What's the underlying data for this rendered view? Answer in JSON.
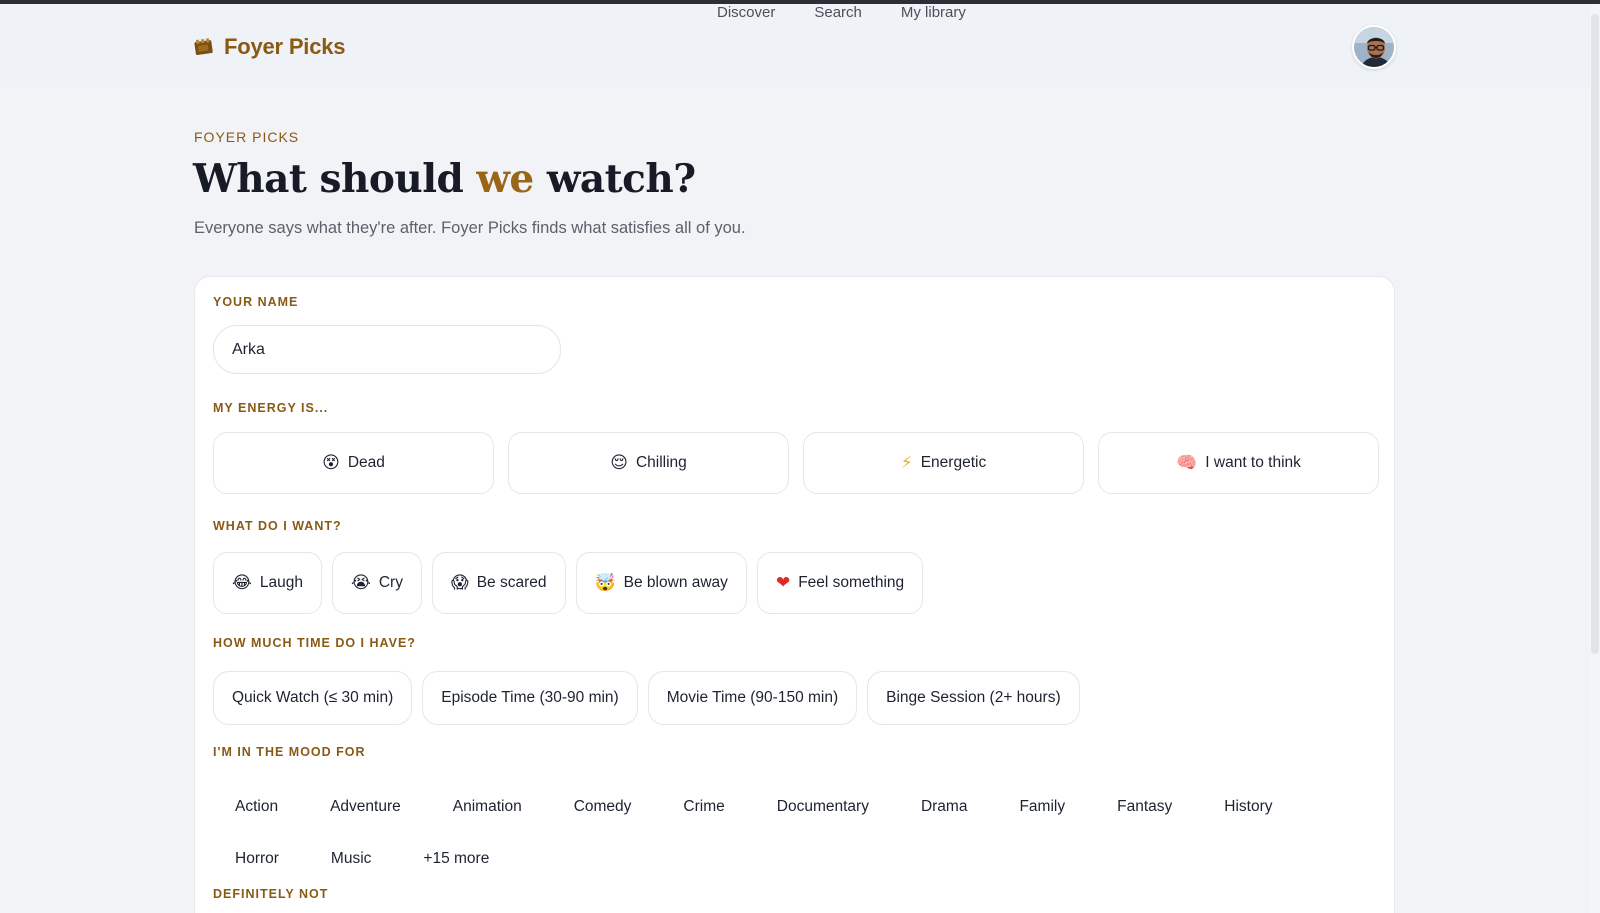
{
  "brand": {
    "name": "Foyer Picks"
  },
  "nav": {
    "items": [
      "Discover",
      "Search",
      "My library"
    ]
  },
  "hero": {
    "eyebrow": "FOYER PICKS",
    "title_before": "What should ",
    "title_accent": "we",
    "title_after": " watch?",
    "subtitle": "Everyone says what they're after. Foyer Picks finds what satisfies all of you."
  },
  "form": {
    "name_label": "YOUR NAME",
    "name_value": "Arka",
    "energy_label": "MY ENERGY IS...",
    "energy_options": [
      {
        "emoji": "😵",
        "label": "Dead"
      },
      {
        "emoji": "😌",
        "label": "Chilling"
      },
      {
        "emoji": "⚡",
        "label": "Energetic"
      },
      {
        "emoji": "🧠",
        "label": "I want to think"
      }
    ],
    "want_label": "WHAT DO I WANT?",
    "want_options": [
      {
        "emoji": "😂",
        "label": "Laugh"
      },
      {
        "emoji": "😭",
        "label": "Cry"
      },
      {
        "emoji": "😱",
        "label": "Be scared"
      },
      {
        "emoji": "🤯",
        "label": "Be blown away"
      },
      {
        "emoji": "❤",
        "label": "Feel something"
      }
    ],
    "time_label": "HOW MUCH TIME DO I HAVE?",
    "time_options": [
      "Quick Watch (≤ 30 min)",
      "Episode Time (30-90 min)",
      "Movie Time (90-150 min)",
      "Binge Session (2+ hours)"
    ],
    "mood_label": "I'M IN THE MOOD FOR",
    "genres_row1": [
      "Action",
      "Adventure",
      "Animation",
      "Comedy",
      "Crime",
      "Documentary",
      "Drama",
      "Family",
      "Fantasy",
      "History"
    ],
    "genres_row2": [
      "Horror",
      "Music",
      "+15 more"
    ],
    "definitely_not_label": "DEFINITELY NOT"
  },
  "colors": {
    "accent": "#8a5a14",
    "title": "#161b26",
    "heart": "#e02a2a"
  }
}
